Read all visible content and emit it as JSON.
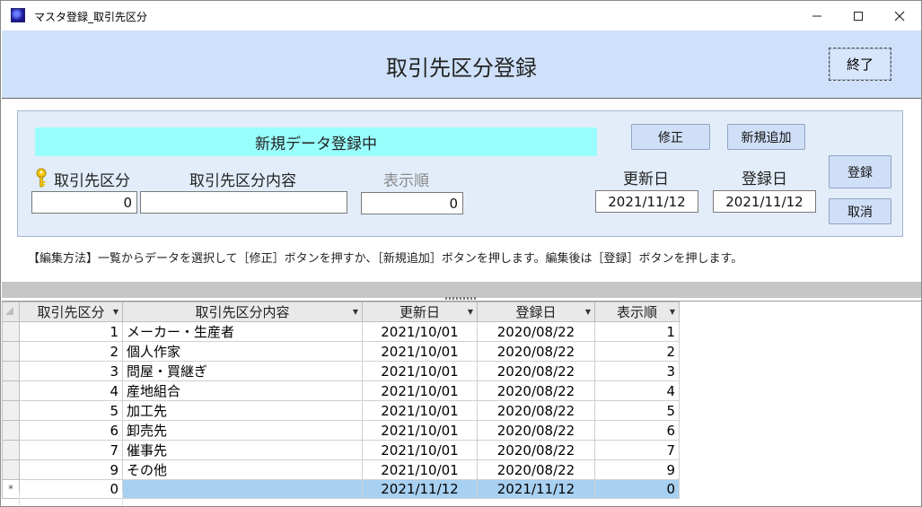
{
  "window": {
    "title": "マスタ登録_取引先区分"
  },
  "header": {
    "title": "取引先区分登録",
    "exit_label": "終了"
  },
  "form": {
    "status": "新規データ登録中",
    "edit_label": "修正",
    "new_label": "新規追加",
    "save_label": "登録",
    "cancel_label": "取消",
    "labels": {
      "code": "取引先区分",
      "content": "取引先区分内容",
      "order": "表示順",
      "updated": "更新日",
      "registered": "登録日"
    },
    "values": {
      "code": "0",
      "content": "",
      "order": "0",
      "updated": "2021/11/12",
      "registered": "2021/11/12"
    }
  },
  "instructions": "【編集方法】一覧からデータを選択して［修正］ボタンを押すか、［新規追加］ボタンを押します。編集後は［登録］ボタンを押します。",
  "grid": {
    "columns": [
      "取引先区分",
      "取引先区分内容",
      "更新日",
      "登録日",
      "表示順"
    ],
    "rows": [
      {
        "code": "1",
        "content": "メーカー・生産者",
        "updated": "2021/10/01",
        "registered": "2020/08/22",
        "order": "1"
      },
      {
        "code": "2",
        "content": "個人作家",
        "updated": "2021/10/01",
        "registered": "2020/08/22",
        "order": "2"
      },
      {
        "code": "3",
        "content": "問屋・買継ぎ",
        "updated": "2021/10/01",
        "registered": "2020/08/22",
        "order": "3"
      },
      {
        "code": "4",
        "content": "産地組合",
        "updated": "2021/10/01",
        "registered": "2020/08/22",
        "order": "4"
      },
      {
        "code": "5",
        "content": "加工先",
        "updated": "2021/10/01",
        "registered": "2020/08/22",
        "order": "5"
      },
      {
        "code": "6",
        "content": "卸売先",
        "updated": "2021/10/01",
        "registered": "2020/08/22",
        "order": "6"
      },
      {
        "code": "7",
        "content": "催事先",
        "updated": "2021/10/01",
        "registered": "2020/08/22",
        "order": "7"
      },
      {
        "code": "9",
        "content": "その他",
        "updated": "2021/10/01",
        "registered": "2020/08/22",
        "order": "9"
      }
    ],
    "new_row": {
      "marker": "*",
      "code": "0",
      "content": "",
      "updated": "2021/11/12",
      "registered": "2021/11/12",
      "order": "0"
    }
  }
}
